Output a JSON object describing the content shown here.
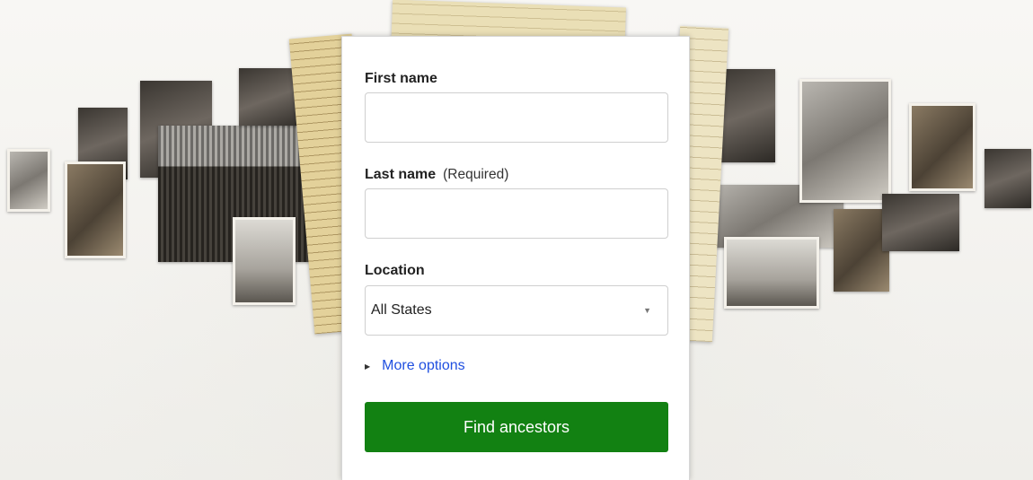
{
  "form": {
    "first_name": {
      "label": "First name",
      "value": "",
      "placeholder": ""
    },
    "last_name": {
      "label": "Last name",
      "hint": "(Required)",
      "value": "",
      "placeholder": ""
    },
    "location": {
      "label": "Location",
      "selected": "All States"
    },
    "more_options_label": "More options",
    "submit_label": "Find ancestors"
  },
  "colors": {
    "submit_button": "#128112",
    "link": "#1f4fe0",
    "card_background": "#ffffff"
  },
  "icons": {
    "dropdown": "chevron-down-icon",
    "expand": "caret-right-icon"
  }
}
